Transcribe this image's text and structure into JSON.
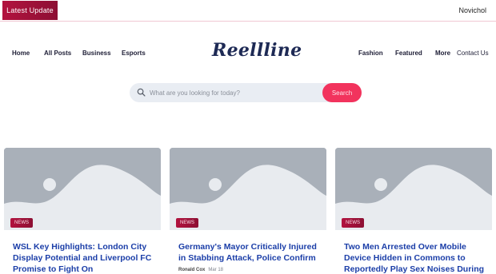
{
  "topbar": {
    "latest_label": "Latest Update",
    "ticker_text": "Novichol"
  },
  "site": {
    "logo": "Reellline"
  },
  "nav": {
    "left": [
      "Home",
      "All Posts",
      "Business",
      "Esports"
    ],
    "right": [
      "Fashion",
      "Featured",
      "More",
      "Contact Us"
    ]
  },
  "search": {
    "placeholder": "What are you looking for today?",
    "button_label": "Search"
  },
  "cards": [
    {
      "tag": "NEWS",
      "title": "WSL Key Highlights: London City Display Potential and Liverpool FC Promise to Fight On",
      "author": "",
      "date": ""
    },
    {
      "tag": "NEWS",
      "title": "Germany's Mayor Critically Injured in Stabbing Attack, Police Confirm",
      "author": "Ronald Cox",
      "date": "Mar 18"
    },
    {
      "tag": "NEWS",
      "title": "Two Men Arrested Over Mobile Device Hidden in Commons to Reportedly Play Sex Noises During",
      "author": "",
      "date": ""
    }
  ],
  "colors": {
    "accent": "#f2335d",
    "badge": "#a3123a",
    "title_link": "#1b3ea8",
    "placeholder_bg": "#a9b0b9"
  }
}
